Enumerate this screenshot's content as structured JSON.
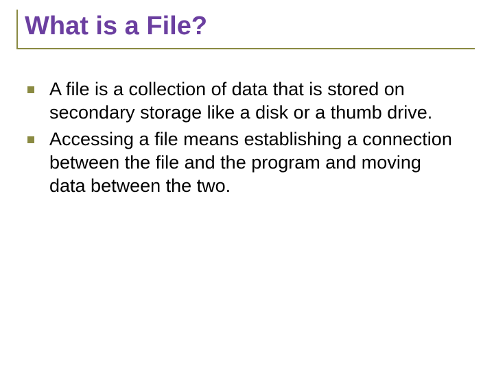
{
  "slide": {
    "title": "What is a File?",
    "bullets": [
      "A file is a collection of data that is stored on secondary storage like a disk or a thumb drive.",
      "Accessing a file means establishing a connection between the file and the program and moving data between the two."
    ]
  }
}
